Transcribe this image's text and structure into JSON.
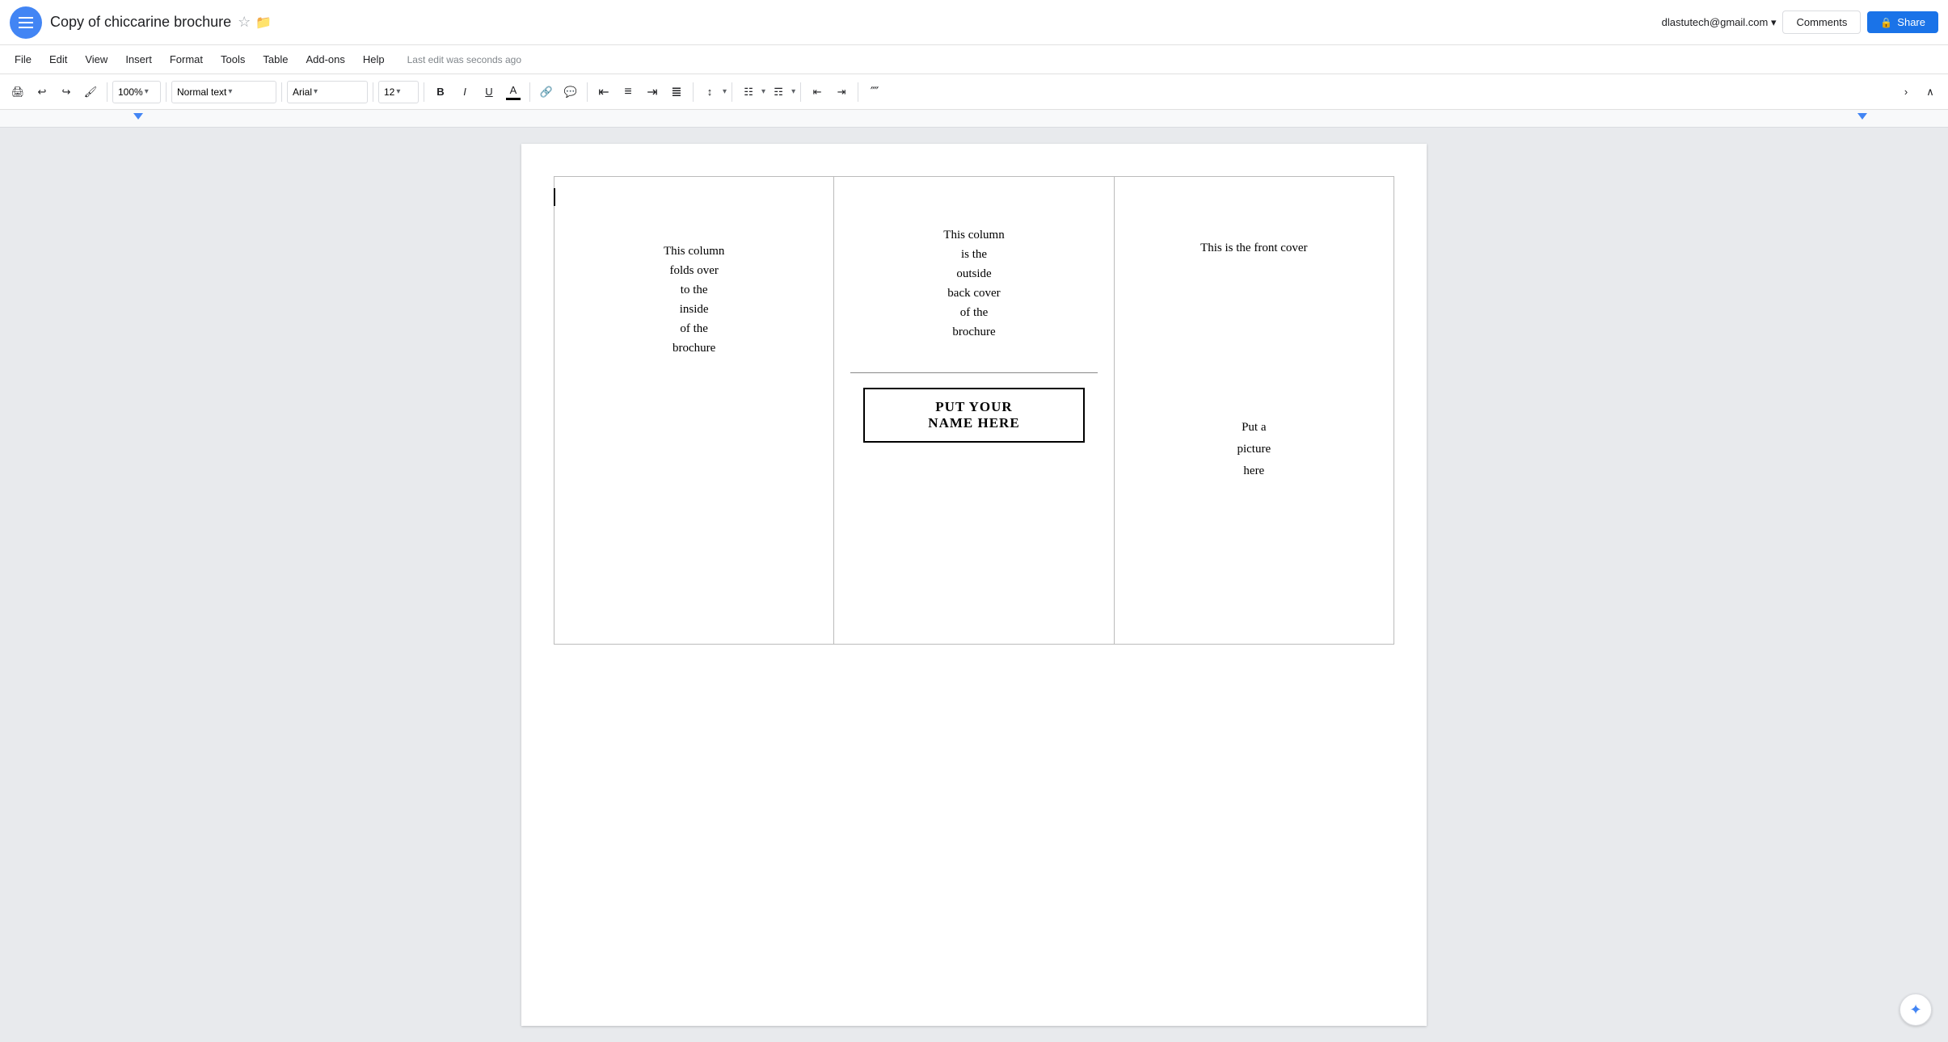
{
  "app": {
    "menu_icon": "☰",
    "title": "Copy of chiccarine brochure",
    "star_icon": "☆",
    "folder_icon": "▬",
    "user_email": "dlastutech@gmail.com",
    "user_dropdown": "▾",
    "comments_label": "Comments",
    "share_label": "Share",
    "lock_icon": "🔒"
  },
  "menu": {
    "items": [
      "File",
      "Edit",
      "View",
      "Insert",
      "Format",
      "Tools",
      "Table",
      "Add-ons",
      "Help"
    ],
    "last_edit": "Last edit was seconds ago"
  },
  "toolbar": {
    "print_icon": "🖨",
    "undo_icon": "↩",
    "redo_icon": "↪",
    "paint_icon": "🖌",
    "zoom": "100%",
    "zoom_arrow": "▾",
    "style": "Normal text",
    "style_arrow": "▾",
    "font": "Arial",
    "font_arrow": "▾",
    "font_size": "12",
    "font_size_arrow": "▾",
    "bold": "B",
    "italic": "I",
    "underline": "U",
    "font_color": "A",
    "link_icon": "🔗",
    "comment_icon": "💬",
    "align_left": "≡",
    "align_center": "≡",
    "align_right": "≡",
    "align_justify": "≡",
    "line_spacing": "↕",
    "list_numbered": "≡",
    "list_bullet": "≡",
    "indent_decrease": "⇤",
    "indent_increase": "⇥",
    "clear_format": "⊘",
    "more_icon": "›",
    "collapse_icon": "∧"
  },
  "document": {
    "col1": {
      "text": "This column\nfolds over\nto the\ninside\nof the\nbrochure"
    },
    "col2": {
      "back_cover_text": "This column\nis the\noutside\nback cover\nof the\nbrochure",
      "name_box_line1": "PUT YOUR",
      "name_box_line2": "NAME HERE"
    },
    "col3": {
      "front_cover_text": "This is the front cover",
      "picture_text_line1": "Put a",
      "picture_text_line2": "picture",
      "picture_text_line3": "here"
    }
  }
}
